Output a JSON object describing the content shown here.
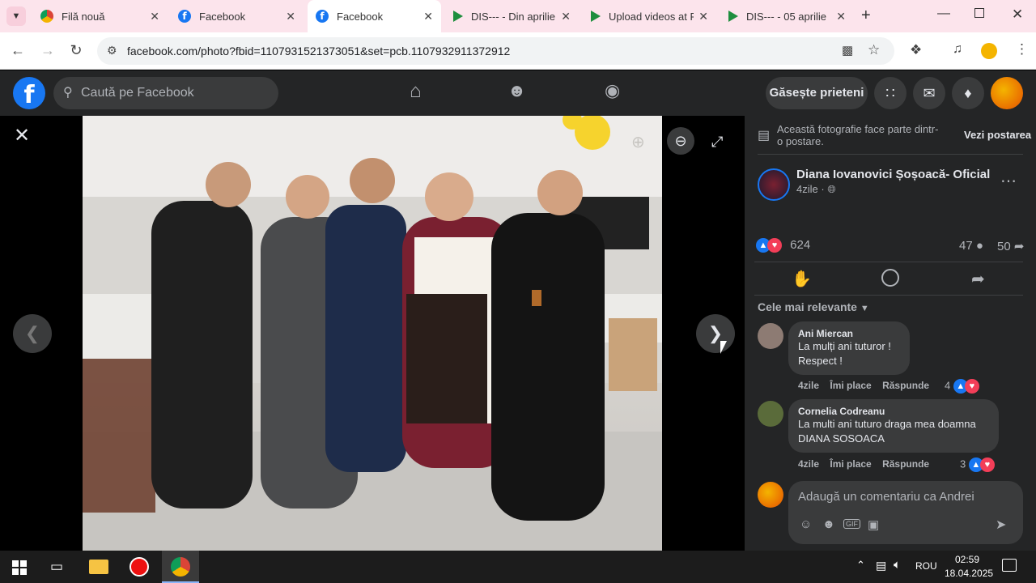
{
  "browser": {
    "tabs": [
      {
        "title": "Filă nouă",
        "favicon": "chrome-icon"
      },
      {
        "title": "Facebook",
        "favicon": "facebook-icon"
      },
      {
        "title": "Facebook",
        "favicon": "facebook-icon"
      },
      {
        "title": "DIS--- - Din aprilie",
        "favicon": "video-icon"
      },
      {
        "title": "Upload videos at R",
        "favicon": "video-icon"
      },
      {
        "title": "DIS--- - 05 aprilie",
        "favicon": "video-icon"
      }
    ],
    "url": "facebook.com/photo?fbid=1107931521373051&set=pcb.1107932911372912"
  },
  "facebook": {
    "search_placeholder": "Caută pe Facebook",
    "find_friends": "Găsește prieteni"
  },
  "panel": {
    "album_note": "Această fotografie face parte dintr-o postare.",
    "see_post": "Vezi postarea",
    "author": "Diana Iovanovici Șoșoacă- Oficial",
    "post_time": "4zile",
    "reactions_count": "624",
    "comments_count": "47",
    "shares_count": "50",
    "sort_label": "Cele mai relevante",
    "comments": [
      {
        "name": "Ani Miercan",
        "text": "La mulți ani tuturor ! Respect !",
        "time": "4zile",
        "like": "Îmi place",
        "reply": "Răspunde",
        "reactions": "4"
      },
      {
        "name": "Cornelia Codreanu",
        "text": "La multi ani tuturo draga mea doamna DIANA SOSOACA",
        "time": "4zile",
        "like": "Îmi place",
        "reply": "Răspunde",
        "reactions": "3"
      }
    ],
    "comment_placeholder": "Adaugă un comentariu ca Andrei"
  },
  "taskbar": {
    "language": "ROU",
    "time": "02:59",
    "date": "18.04.2025"
  },
  "colors": {
    "fb_blue": "#1877f2",
    "fb_dark": "#242526",
    "fb_surface": "#3a3b3c",
    "tab_bar": "#fce4ec"
  }
}
